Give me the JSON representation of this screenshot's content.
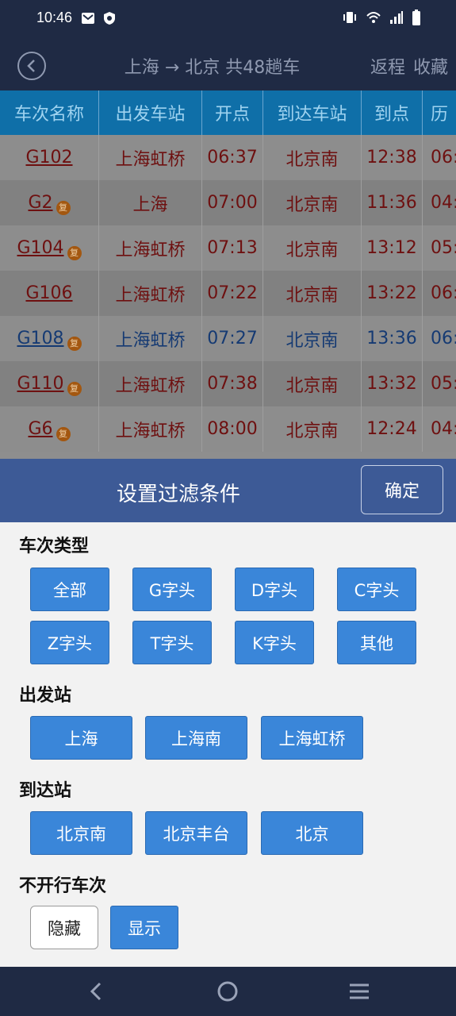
{
  "status": {
    "time": "10:46"
  },
  "header": {
    "title": "上海 → 北京 共48趟车",
    "return_label": "返程",
    "favorite_label": "收藏"
  },
  "table": {
    "columns": [
      "车次名称",
      "出发车站",
      "开点",
      "到达车站",
      "到点",
      "历"
    ],
    "rows": [
      {
        "train": "G102",
        "badge": "",
        "from": "上海虹桥",
        "dep": "06:37",
        "to": "北京南",
        "arr": "12:38",
        "dur": "06:",
        "color": "#6e1010"
      },
      {
        "train": "G2",
        "badge": "复",
        "from": "上海",
        "dep": "07:00",
        "to": "北京南",
        "arr": "11:36",
        "dur": "04:",
        "color": "#6e1010"
      },
      {
        "train": "G104",
        "badge": "复",
        "from": "上海虹桥",
        "dep": "07:13",
        "to": "北京南",
        "arr": "13:12",
        "dur": "05:",
        "color": "#6e1010"
      },
      {
        "train": "G106",
        "badge": "",
        "from": "上海虹桥",
        "dep": "07:22",
        "to": "北京南",
        "arr": "13:22",
        "dur": "06:",
        "color": "#6e1010"
      },
      {
        "train": "G108",
        "badge": "复",
        "from": "上海虹桥",
        "dep": "07:27",
        "to": "北京南",
        "arr": "13:36",
        "dur": "06:",
        "color": "#153a73"
      },
      {
        "train": "G110",
        "badge": "复",
        "from": "上海虹桥",
        "dep": "07:38",
        "to": "北京南",
        "arr": "13:32",
        "dur": "05:",
        "color": "#6e1010"
      },
      {
        "train": "G6",
        "badge": "复",
        "from": "上海虹桥",
        "dep": "08:00",
        "to": "北京南",
        "arr": "12:24",
        "dur": "04:",
        "color": "#6e1010"
      }
    ]
  },
  "filter": {
    "title": "设置过滤条件",
    "confirm_label": "确定",
    "train_type": {
      "label": "车次类型",
      "options": [
        "全部",
        "G字头",
        "D字头",
        "C字头",
        "Z字头",
        "T字头",
        "K字头",
        "其他"
      ]
    },
    "departure": {
      "label": "出发站",
      "options": [
        "上海",
        "上海南",
        "上海虹桥"
      ]
    },
    "arrival": {
      "label": "到达站",
      "options": [
        "北京南",
        "北京丰台",
        "北京"
      ]
    },
    "not_running": {
      "label": "不开行车次",
      "options": [
        "隐藏",
        "显示"
      ],
      "selected": "显示"
    }
  },
  "colors": {
    "header_bg": "#1f2a44",
    "table_header_bg": "#0f6fa8",
    "filter_header_bg": "#3d5a96",
    "option_bg": "#3a86d9"
  }
}
